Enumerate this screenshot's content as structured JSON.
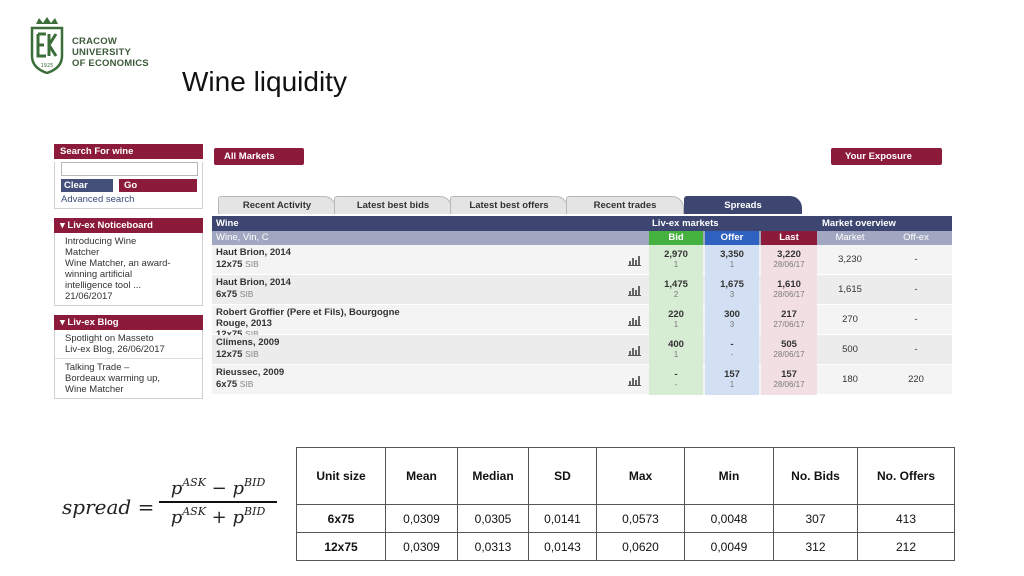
{
  "logo": {
    "line1": "CRACOW",
    "line2": "UNIVERSITY",
    "line3": "OF ECONOMICS",
    "year": "1925",
    "mark": "UEK"
  },
  "slide_title": "Wine liquidity",
  "sidebar": {
    "search_title": "Search For wine",
    "clear": "Clear",
    "go": "Go",
    "advanced": "Advanced search",
    "noticeboard_title": "▾ Liv-ex Noticeboard",
    "notice_lines": [
      "Introducing Wine",
      "Matcher",
      "Wine Matcher, an award-",
      "winning artificial",
      "intelligence tool ...",
      "21/06/2017"
    ],
    "blog_title": "▾ Liv-ex Blog",
    "blog1_lines": [
      "Spotlight on Masseto",
      "Liv-ex Blog, 26/06/2017"
    ],
    "blog2_lines": [
      "Talking Trade –",
      "Bordeaux warming up,",
      "Wine Matcher"
    ]
  },
  "main": {
    "all_markets": "All Markets",
    "your_exposure": "Your Exposure",
    "tabs": [
      "Recent Activity",
      "Latest best bids",
      "Latest best offers",
      "Recent trades",
      "Spreads"
    ],
    "header": {
      "wine": "Wine",
      "livex_markets": "Liv-ex markets",
      "market_overview": "Market overview"
    },
    "subheader": {
      "wine": "Wine, Vin, C",
      "bid": "Bid",
      "offer": "Offer",
      "last": "Last",
      "market": "Market",
      "offex": "Off-ex"
    },
    "rows": [
      {
        "name1": "Haut Brion, 2014",
        "name2": "",
        "size": "12x75",
        "sib": "SIB",
        "bid": "2,970",
        "bid_n": "1",
        "offer": "3,350",
        "offer_n": "1",
        "last": "3,220",
        "last_date": "28/06/17",
        "market": "3,230",
        "offex": "-"
      },
      {
        "name1": "Haut Brion, 2014",
        "name2": "",
        "size": "6x75",
        "sib": "SIB",
        "bid": "1,475",
        "bid_n": "2",
        "offer": "1,675",
        "offer_n": "3",
        "last": "1,610",
        "last_date": "28/06/17",
        "market": "1,615",
        "offex": "-"
      },
      {
        "name1": "Robert Groffier (Pere et Fils), Bourgogne",
        "name2": "Rouge, 2013",
        "size": "12x75",
        "sib": "SIB",
        "bid": "220",
        "bid_n": "1",
        "offer": "300",
        "offer_n": "3",
        "last": "217",
        "last_date": "27/06/17",
        "market": "270",
        "offex": "-"
      },
      {
        "name1": "Climens, 2009",
        "name2": "",
        "size": "12x75",
        "sib": "SIB",
        "bid": "400",
        "bid_n": "1",
        "offer": "-",
        "offer_n": "-",
        "last": "505",
        "last_date": "28/06/17",
        "market": "500",
        "offex": "-"
      },
      {
        "name1": "Rieussec, 2009",
        "name2": "",
        "size": "6x75",
        "sib": "SIB",
        "bid": "-",
        "bid_n": "-",
        "offer": "157",
        "offer_n": "1",
        "last": "157",
        "last_date": "28/06/17",
        "market": "180",
        "offex": "220"
      }
    ]
  },
  "formula": {
    "lhs": "spread",
    "eq": "=",
    "p": "p",
    "ask": "ASK",
    "bid": "BID",
    "minus": "−",
    "plus": "+"
  },
  "stats": {
    "headers": [
      "Unit size",
      "Mean",
      "Median",
      "SD",
      "Max",
      "Min",
      "No. Bids",
      "No. Offers"
    ],
    "rows": [
      [
        "6x75",
        "0,0309",
        "0,0305",
        "0,0141",
        "0,0573",
        "0,0048",
        "307",
        "413"
      ],
      [
        "12x75",
        "0,0309",
        "0,0313",
        "0,0143",
        "0,0620",
        "0,0049",
        "312",
        "212"
      ]
    ]
  }
}
